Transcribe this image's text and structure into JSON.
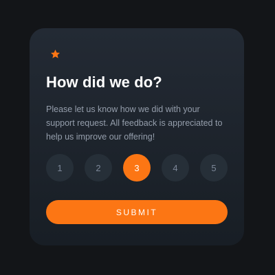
{
  "card": {
    "icon": "star-icon",
    "title": "How did we do?",
    "description": "Please let us know how we did with your support request. All feedback is appreciated to help us improve our offering!"
  },
  "ratings": {
    "options": [
      "1",
      "2",
      "3",
      "4",
      "5"
    ],
    "selected": "3"
  },
  "submit": {
    "label": "SUBMIT"
  },
  "colors": {
    "accent": "#fc7614",
    "background": "#131518",
    "card": "#202731",
    "rating_bg": "#262f38"
  }
}
